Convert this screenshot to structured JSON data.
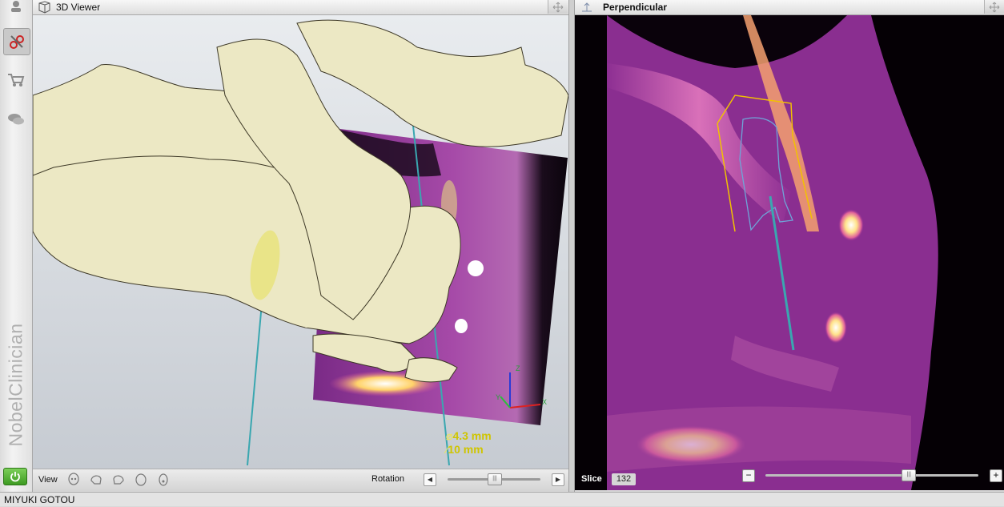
{
  "viewer3d": {
    "title": "3D Viewer",
    "implant": {
      "diameter": "4.3 mm",
      "length": "10 mm"
    },
    "axes": {
      "z": "Z",
      "y": "Y",
      "x": "X"
    },
    "toolbar": {
      "view_label": "View",
      "rotation_label": "Rotation",
      "rotation_fraction": 0.5
    }
  },
  "perpendicular": {
    "title": "Perpendicular",
    "slice_label": "Slice",
    "slice_value": "132",
    "slice_fraction": 0.67,
    "minus": "−",
    "plus": "+"
  },
  "brand": "NobelClinician",
  "status": {
    "patient": "MIYUKI GOTOU"
  },
  "colors": {
    "implant_outline": "#f2c200",
    "implant_body": "#4aa7c4",
    "guide_line": "#3aa7b0",
    "bone": "#ece8c4",
    "ct_magenta": "#a03ca8"
  },
  "icons": {
    "rail": [
      "patient-icon",
      "planning-icon",
      "cart-icon",
      "chat-icon"
    ],
    "views": [
      "skull-front-icon",
      "skull-left-icon",
      "skull-right-icon",
      "skull-back-icon",
      "skull-top-icon"
    ]
  }
}
